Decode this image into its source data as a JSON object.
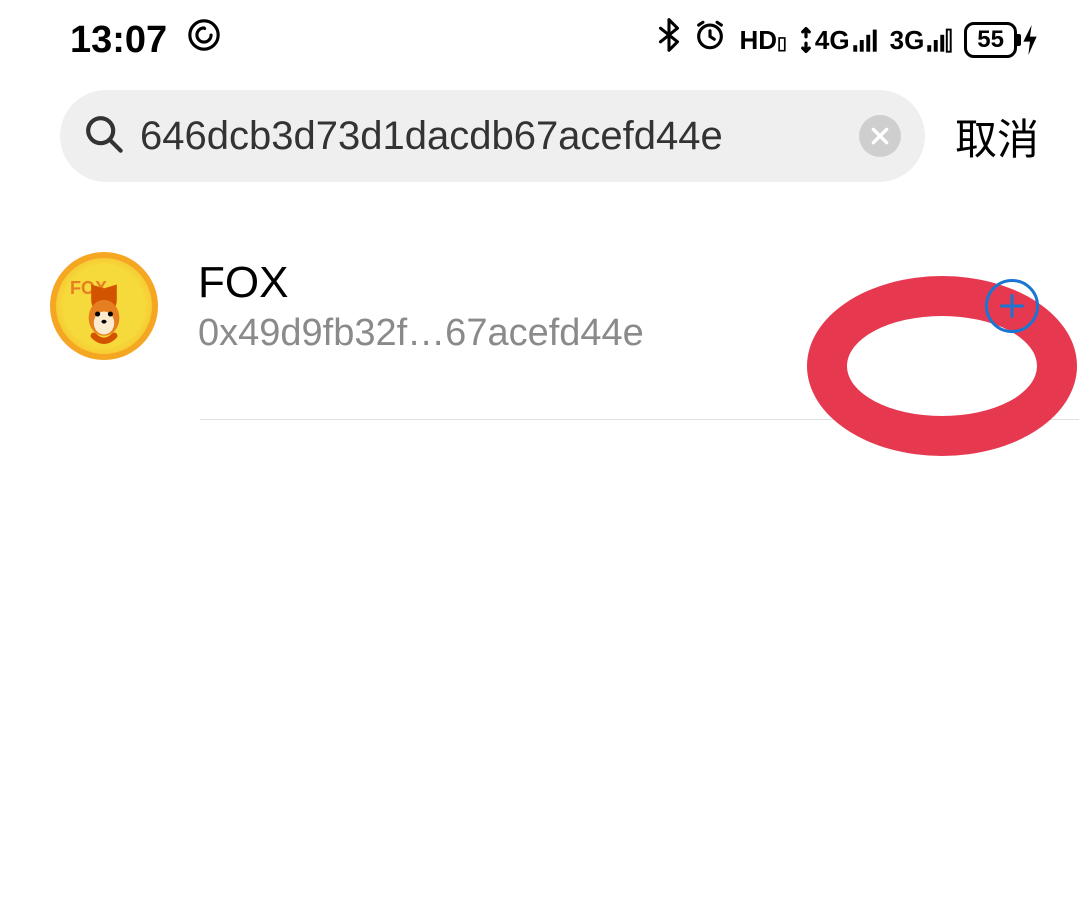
{
  "status_bar": {
    "time": "13:07",
    "battery": "55",
    "network1_label": "4G",
    "network2_label": "3G",
    "hd_label": "HD"
  },
  "search": {
    "value": "646dcb3d73d1dacdb67acefd44e",
    "cancel_label": "取消"
  },
  "result": {
    "token_name": "FOX",
    "token_symbol": "FOX",
    "token_address": "0x49d9fb32f…67acefd44e"
  }
}
